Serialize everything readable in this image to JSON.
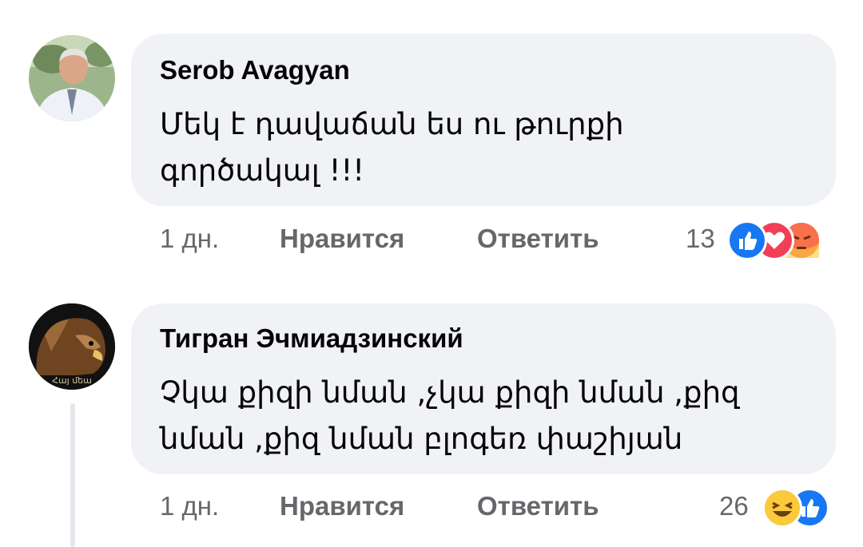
{
  "comments": [
    {
      "author": "Serob Avagyan",
      "lines": [
        "Մեկ է դավաճան ես ու թուրքի",
        "գործակալ !!!"
      ],
      "time": "1 дн.",
      "like_label": "Нравится",
      "reply_label": "Ответить",
      "reaction_count": "13",
      "reactions": [
        "like-icon",
        "love-icon",
        "angry-icon"
      ]
    },
    {
      "author": "Тигран Эчмиадзинский",
      "lines": [
        "Չկա քիզի նման ,չկա քիզի նման ,քիզ",
        "նման ,քիզ նման բլոգեռ փաշիյան"
      ],
      "time": "1 дн.",
      "like_label": "Нравится",
      "reply_label": "Ответить",
      "reaction_count": "26",
      "reactions": [
        "haha-icon",
        "like-icon"
      ],
      "avatar_caption": "Հայ մեա"
    }
  ],
  "colors": {
    "bubble": "#f0f2f5",
    "like": "#1877f2",
    "love": "#f33e58",
    "angry": "#f7714c"
  }
}
